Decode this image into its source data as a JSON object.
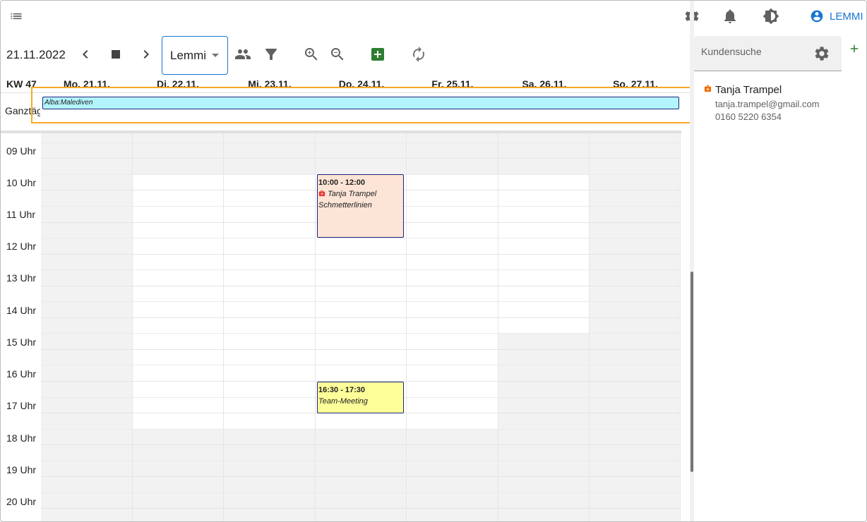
{
  "appbar": {
    "icons": [
      "format-list-icon",
      "gear-icon",
      "bell-icon",
      "brightness-icon",
      "account-circle-icon"
    ],
    "user_label": "LEMMI",
    "accent": "#1976d2"
  },
  "toolbar": {
    "date": "21.11.2022",
    "calendar_select": "Lemmi",
    "add_color": "#2e7d32"
  },
  "calendar": {
    "week_label": "KW 47",
    "days": [
      "Mo. 21.11.",
      "Di. 22.11.",
      "Mi. 23.11.",
      "Do. 24.11.",
      "Fr. 25.11.",
      "Sa. 26.11.",
      "So. 27.11."
    ],
    "allday_label": "Ganztägig",
    "allday_event": "Alba:Malediven",
    "hours": [
      "09 Uhr",
      "10 Uhr",
      "11 Uhr",
      "12 Uhr",
      "13 Uhr",
      "14 Uhr",
      "15 Uhr",
      "16 Uhr",
      "17 Uhr",
      "18 Uhr",
      "19 Uhr",
      "20 Uhr"
    ],
    "events": [
      {
        "time": "10:00 - 12:00",
        "customer": "Tanja Trampel",
        "title": "Schmetterlinien",
        "color": "#fce4d6"
      },
      {
        "time": "16:30 - 17:30",
        "title": "Team-Meeting",
        "color": "#ffff99"
      }
    ]
  },
  "side": {
    "search_placeholder": "Kundensuche",
    "customer": {
      "name": "Tanja Trampel",
      "email": "tanja.trampel@gmail.com",
      "phone": "0160 5220 6354",
      "icon_color": "#ef6c00"
    }
  }
}
